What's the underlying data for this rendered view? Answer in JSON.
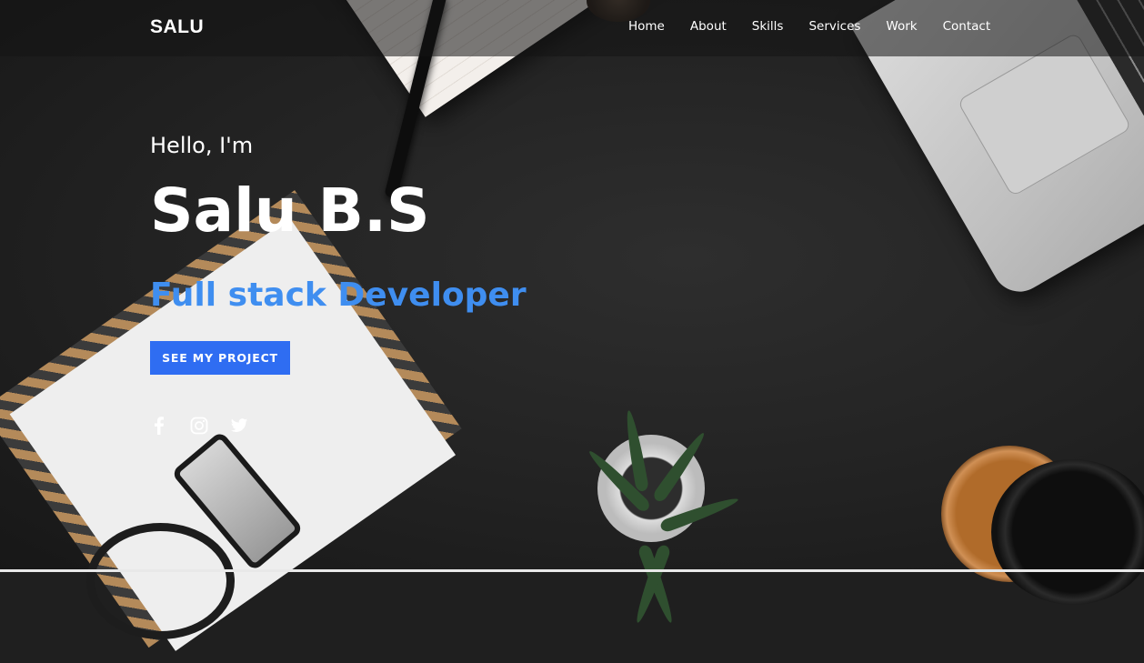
{
  "header": {
    "logo": "SALU",
    "nav": [
      {
        "label": "Home"
      },
      {
        "label": "About"
      },
      {
        "label": "Skills"
      },
      {
        "label": "Services"
      },
      {
        "label": "Work"
      },
      {
        "label": "Contact"
      }
    ]
  },
  "hero": {
    "greeting": "Hello, I'm",
    "name": "Salu B.S",
    "role": "Full stack Developer",
    "cta_label": "SEE MY PROJECT"
  },
  "socials": [
    {
      "icon": "facebook-icon"
    },
    {
      "icon": "instagram-icon"
    },
    {
      "icon": "twitter-icon"
    }
  ],
  "colors": {
    "accent": "#3f8ef0",
    "button": "#2f6df2",
    "background": "#1f1f1f",
    "text": "#ffffff"
  }
}
